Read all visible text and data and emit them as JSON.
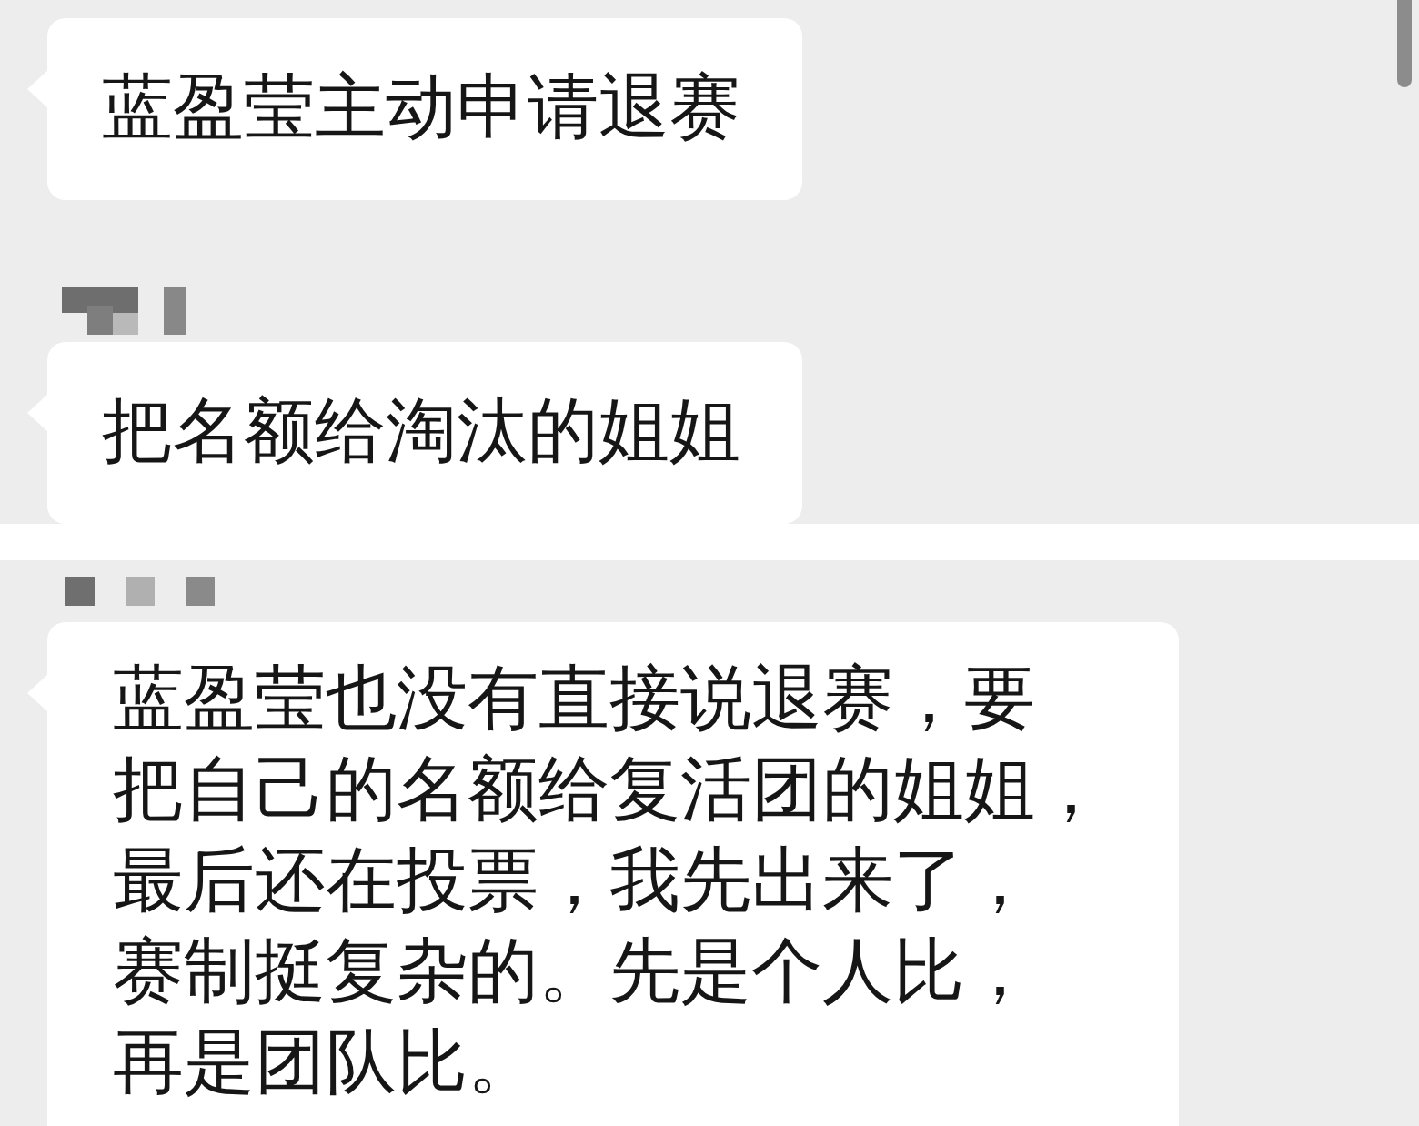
{
  "panels": [
    {
      "messages": [
        {
          "sender_hidden": false,
          "lines": [
            "蓝盈莹主动申请退赛"
          ]
        },
        {
          "sender_hidden": true,
          "lines": [
            "把名额给淘汰的姐姐"
          ]
        }
      ]
    },
    {
      "messages": [
        {
          "sender_hidden": true,
          "lines": [
            "蓝盈莹也没有直接说退赛，要",
            "把自己的名额给复活团的姐姐，",
            "最后还在投票，我先出来了，",
            "赛制挺复杂的。先是个人比，",
            "再是团队比。"
          ]
        }
      ]
    }
  ]
}
